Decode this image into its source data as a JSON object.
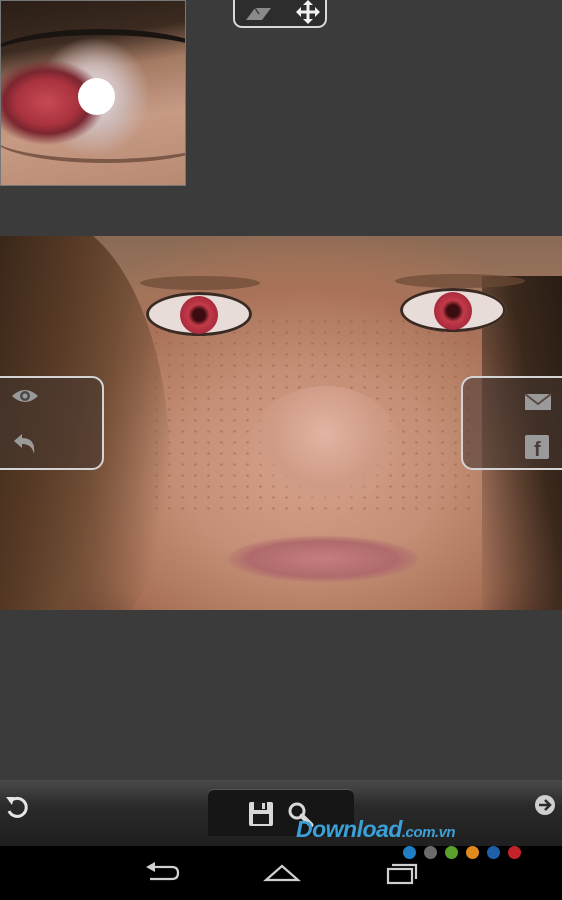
{
  "toolbar_top": {
    "erase_icon": "eraser-icon",
    "move_icon": "move-arrows-icon"
  },
  "left_panel": {
    "preview_icon": "eye-icon",
    "undo_icon": "undo-icon"
  },
  "right_panel": {
    "email_icon": "envelope-icon",
    "facebook_icon": "facebook-icon",
    "facebook_letter": "f"
  },
  "bottom_bar": {
    "rotate_icon": "rotate-icon",
    "save_icon": "floppy-disk-icon",
    "zoom_icon": "magnifier-icon",
    "next_icon": "arrow-right-circle-icon"
  },
  "watermark": {
    "text": "Download",
    "suffix": ".com.vn",
    "dot_colors": [
      "#1f7ec4",
      "#6b6b6b",
      "#5aa02c",
      "#e08a1e",
      "#1f5fa8",
      "#c4222a"
    ]
  },
  "system_nav": {
    "back_icon": "back-icon",
    "home_icon": "home-icon",
    "recents_icon": "recent-apps-icon"
  },
  "colors": {
    "background": "#3b3b3b",
    "panel_border": "#d4d4d4",
    "watermark": "#3aa0d8"
  }
}
